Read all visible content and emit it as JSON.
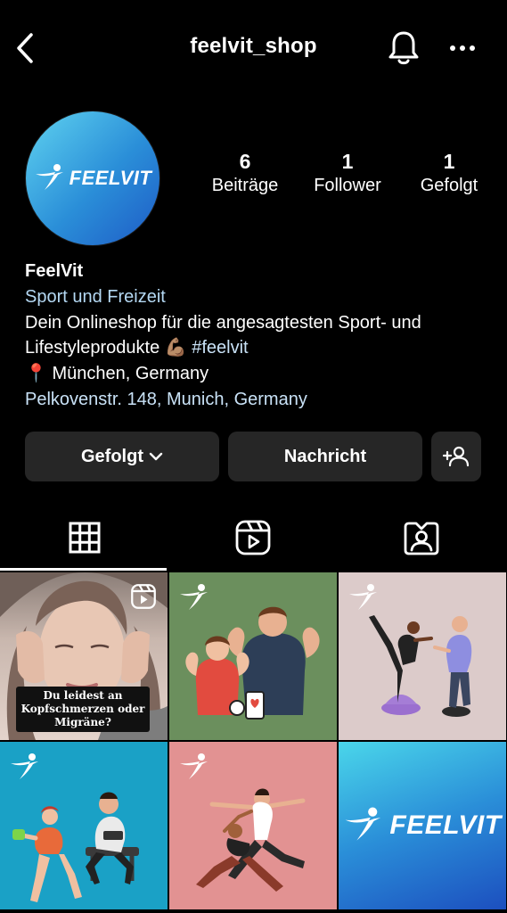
{
  "header": {
    "username": "feelvit_shop"
  },
  "profile": {
    "avatar_text": "FEELVIT",
    "stats": [
      {
        "value": "6",
        "label": "Beiträge"
      },
      {
        "value": "1",
        "label": "Follower"
      },
      {
        "value": "1",
        "label": "Gefolgt"
      }
    ],
    "name": "FeelVit",
    "category": "Sport und Freizeit",
    "bio_line1": "Dein Onlineshop für die angesagtesten Sport- und",
    "bio_line2": "Lifestyleprodukte 💪🏽 ",
    "hashtag": "#feelvit",
    "location": "📍 München, Germany",
    "address": "Pelkovenstr. 148, Munich, Germany"
  },
  "actions": {
    "follow_label": "Gefolgt",
    "message_label": "Nachricht"
  },
  "tabs": [
    {
      "icon": "grid-icon",
      "active": true
    },
    {
      "icon": "reels-icon",
      "active": false
    },
    {
      "icon": "tagged-icon",
      "active": false
    }
  ],
  "posts": {
    "post1_caption": "Du leidest an Kopfschmerzen oder Migräne?",
    "post6_text": "FEELVIT"
  },
  "colors": {
    "background": "#000000",
    "button": "#262626",
    "link": "#c9e2f7",
    "brand_gradient_start": "#4ad6ea",
    "brand_gradient_end": "#1c4fbf"
  }
}
